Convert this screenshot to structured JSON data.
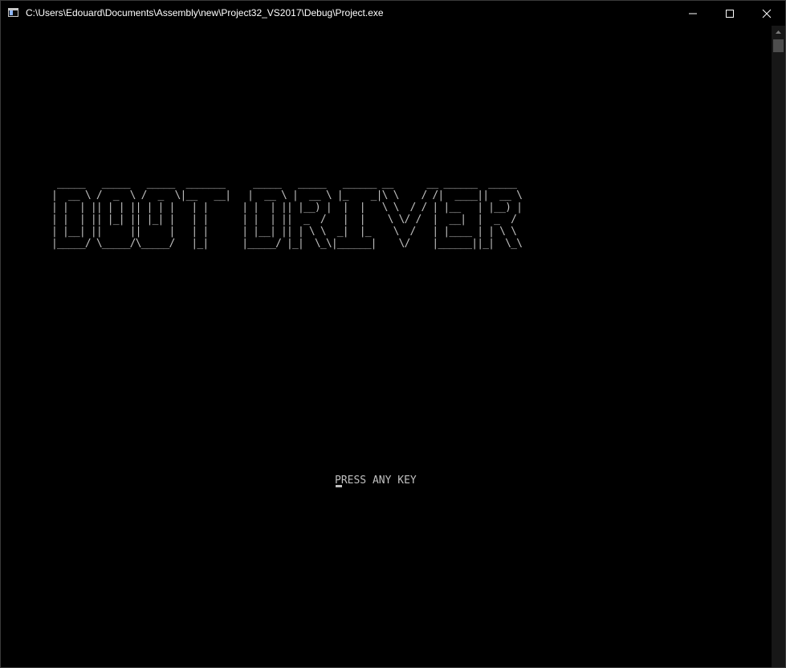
{
  "window": {
    "title": "C:\\Users\\Edouard\\Documents\\Assembly\\new\\Project32_VS2017\\Debug\\Project.exe",
    "icon": "console-app-icon",
    "controls": {
      "minimize": "minimize-icon",
      "maximize": "maximize-icon",
      "close": "close-icon"
    }
  },
  "console": {
    "title_art": " _____   _____   _____  _______     _____   _____   ______ __      __ ______  _____  \n|  __ \\ /  _  \\ /  _  \\|__   __|   |  __ \\ |  __ \\ |_    _|\\ \\    / /|  ____||  __ \\ \n| |  | || | | || | | |   | |      | |  | || |__) |  |  |   \\ \\  / / | |__   | |__) |\n| |  | || |_| || |_| |   | |      | |  | ||  _  /   |  |    \\ \\/ /  |  __|  |  _  / \n| |__| ||     ||     |   | |      | |__| || | \\ \\  _|  |_    \\  /   | |____ | | \\ \\ \n|_____/ \\_____/\\_____/   |_|      |_____/ |_|  \\_\\|______|    \\/    |______||_|  \\_\\",
    "prompt": "PRESS ANY KEY",
    "text_color": "#c0c0c0",
    "background": "#000000"
  },
  "colors": {
    "titlebar_bg": "#000000",
    "titlebar_text": "#ffffff",
    "scrollbar_track": "#171717",
    "scrollbar_thumb": "#4d4d4d"
  }
}
